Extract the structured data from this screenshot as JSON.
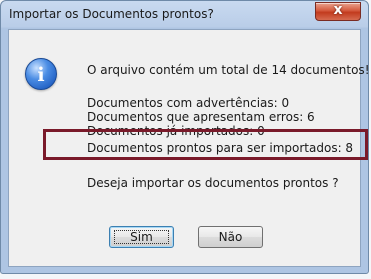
{
  "window": {
    "title": "Importar os Documentos prontos?",
    "close_label": "x"
  },
  "dialog": {
    "icon": "information-icon",
    "icon_glyph": "i",
    "total_message": "O arquivo contém um total de 14 documentos!",
    "warnings_line": "Documentos com advertências: 0",
    "errors_line": "Documentos que apresentam erros:  6",
    "imported_line": "Documentos já importados: 0",
    "ready_line": "Documentos prontos para ser importados: 8",
    "question": "Deseja importar os documentos prontos ?"
  },
  "buttons": {
    "yes_label": "Sim",
    "no_label": "Não"
  },
  "colors": {
    "highlight_border": "#7a1a2a",
    "close_button": "#c23b1e"
  }
}
